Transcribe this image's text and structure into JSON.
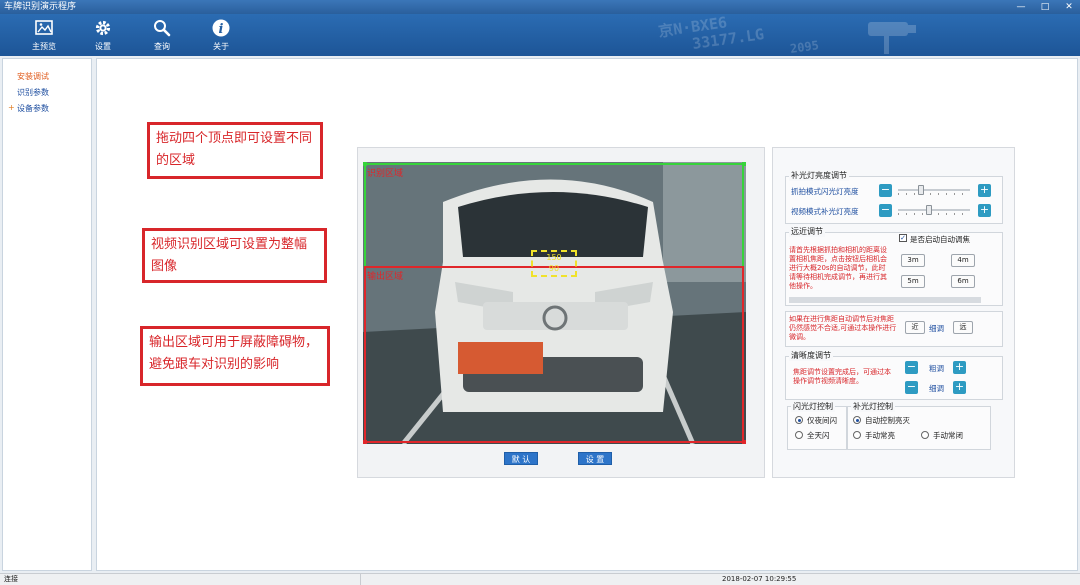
{
  "window": {
    "title": "车牌识别演示程序",
    "controls": [
      "—",
      "□",
      "✕"
    ]
  },
  "toolbar": {
    "items": [
      {
        "label": "主预览",
        "icon": "preview-icon"
      },
      {
        "label": "设置",
        "icon": "gear-icon"
      },
      {
        "label": "查询",
        "icon": "search-icon"
      },
      {
        "label": "关于",
        "icon": "info-icon"
      }
    ],
    "plates": [
      "京N·BXE6",
      "33177.LG",
      "2095"
    ]
  },
  "sidebar": {
    "items": [
      {
        "label": "安装调试",
        "active": true
      },
      {
        "label": "识别参数",
        "active": false
      },
      {
        "label": "设备参数",
        "active": false,
        "expander": "+"
      }
    ]
  },
  "callouts": [
    "拖动四个顶点即可设置不同的区域",
    "视频识别区域可设置为整幅图像",
    "输出区域可用于屏蔽障碍物，避免跟车对识别的影响"
  ],
  "video": {
    "recognition_region_label": "识别区域",
    "output_region_label": "输出区域",
    "focus_top": "150",
    "focus_bottom": "90",
    "default_button": "默 认",
    "set_button": "设 置"
  },
  "fill_light": {
    "title": "补光灯亮度调节",
    "snap_label": "抓拍模式闪光灯亮度",
    "video_label": "视频模式补光灯亮度",
    "snap_level": 0.3,
    "video_level": 0.42
  },
  "focus": {
    "title": "远近调节",
    "auto_focus_label": "是否启动自动调焦",
    "auto_focus_checked": true,
    "hint": "请首先根据抓拍和相机的距离设置相机焦距，点击按钮后相机会进行大概20s的自动调节，此时请等待相机完成调节，再进行其他操作。",
    "buttons": [
      "3m",
      "4m",
      "5m",
      "6m"
    ],
    "adjust_hint": "如果在进行焦距自动调节后对焦距仍然感觉不合适,可通过本操作进行微调。",
    "near": "近",
    "fine": "细调",
    "far": "远"
  },
  "clarity": {
    "title": "清晰度调节",
    "hint": "焦距调节设置完成后，可通过本操作调节视频清晰度。",
    "coarse": "粗调",
    "fine": "细调"
  },
  "flash_control": {
    "title": "闪光灯控制",
    "options": [
      "仅夜间闪",
      "全天闪"
    ],
    "selected": 0
  },
  "fill_light_control": {
    "title": "补光灯控制",
    "options": [
      "自动控制亮灭",
      "手动常亮",
      "手动常闭"
    ],
    "selected": 0
  },
  "status": {
    "connection": "连接",
    "datetime": "2018-02-07 10:29:55"
  }
}
